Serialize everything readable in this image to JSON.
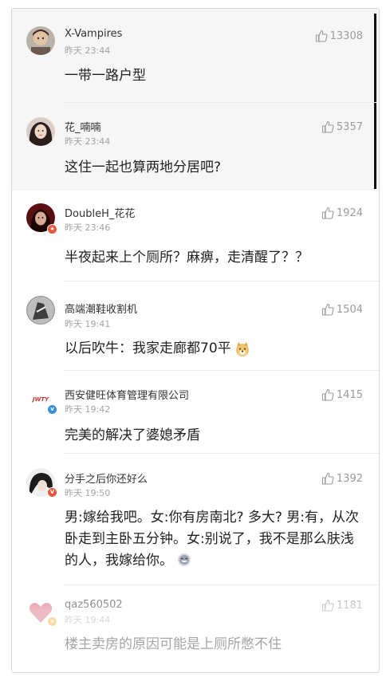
{
  "comments": [
    {
      "user": "X-Vampires",
      "time": "昨天 23:44",
      "likes": "13308",
      "text": "一带一路户型"
    },
    {
      "user": "花_喃喃",
      "time": "昨天 23:44",
      "likes": "5357",
      "text": "这住一起也算两地分居吧?"
    },
    {
      "user": "DoubleH_花花",
      "time": "昨天 23:46",
      "likes": "1924",
      "text": "半夜起来上个厕所？麻痹，走清醒了？？"
    },
    {
      "user": "高端潮鞋收割机",
      "time": "昨天 19:41",
      "likes": "1504",
      "text": "以后吹牛：我家走廊都70平"
    },
    {
      "user": "西安健旺体育管理有限公司",
      "time": "昨天 19:42",
      "likes": "1415",
      "text": "完美的解决了婆媳矛盾"
    },
    {
      "user": "分手之后你还好么",
      "time": "昨天 19:50",
      "likes": "1392",
      "text": "男:嫁给我吧。女:你有房南北? 多大? 男:有，从次卧走到主卧五分钟。女:别说了，我不是那么肤浅的人，我嫁给你。"
    },
    {
      "user": "qaz560502",
      "time": "昨天 19:44",
      "likes": "1181",
      "text": "楼主卖房的原因可能是上厕所憋不住"
    }
  ],
  "colors": {
    "accent_badge": "#e8553a",
    "verified_badge": "#3a8fd9"
  }
}
